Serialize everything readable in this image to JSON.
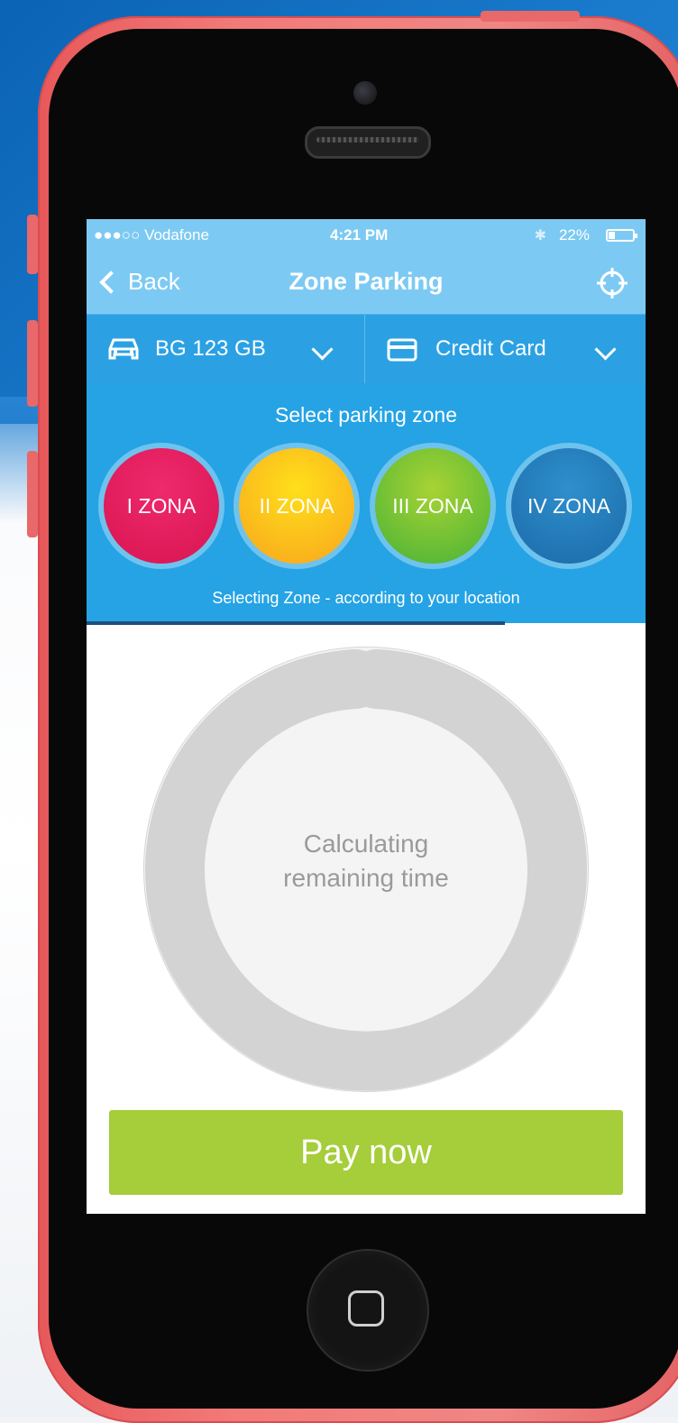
{
  "status_bar": {
    "carrier": "●●●○○ Vodafone",
    "time": "4:21 PM",
    "battery": "22%"
  },
  "nav": {
    "back_label": "Back",
    "title": "Zone Parking",
    "locate_icon": "crosshair-icon"
  },
  "selectors": {
    "vehicle": {
      "icon": "car-icon",
      "value": "BG 123 GB"
    },
    "payment": {
      "icon": "credit-card-icon",
      "value": "Credit Card"
    }
  },
  "zones": {
    "title": "Select parking zone",
    "items": [
      {
        "label": "I ZONA",
        "color": "#e51a5a"
      },
      {
        "label": "II ZONA",
        "color": "#fcc21b"
      },
      {
        "label": "III ZONA",
        "color": "#6cc13a"
      },
      {
        "label": "IV ZONA",
        "color": "#2278b8"
      }
    ],
    "note": "Selecting Zone - according to your location"
  },
  "timer": {
    "line1": "Calculating",
    "line2": "remaining time"
  },
  "pay_button": "Pay now",
  "colors": {
    "header": "#7ccaf3",
    "panel": "#25a3e4",
    "pay": "#a6cd3a",
    "phone_shell": "#f07b78"
  }
}
